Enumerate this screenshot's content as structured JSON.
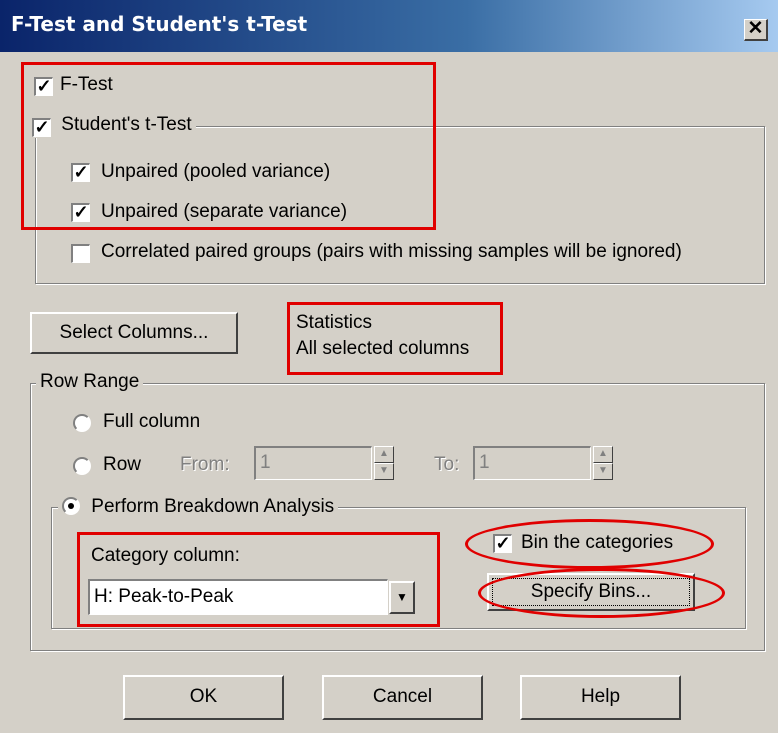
{
  "window": {
    "title": "F-Test and Student's t-Test",
    "close_glyph": "✕"
  },
  "tests": {
    "ftest": {
      "label": "F-Test",
      "checked": true
    },
    "ttest": {
      "label": "Student's t-Test",
      "checked": true
    },
    "options": [
      {
        "label": "Unpaired (pooled variance)",
        "checked": true
      },
      {
        "label": "Unpaired (separate variance)",
        "checked": true
      },
      {
        "label": "Correlated paired groups (pairs with missing samples will be ignored)",
        "checked": false
      }
    ]
  },
  "select_columns": {
    "label": "Select Columns..."
  },
  "statistics": {
    "line1": "Statistics",
    "line2": "All selected columns"
  },
  "row_range": {
    "legend": "Row Range",
    "full_column": "Full column",
    "row": "Row",
    "from_label": "From:",
    "from_value": "1",
    "to_label": "To:",
    "to_value": "1",
    "breakdown": "Perform Breakdown Analysis",
    "selected": "breakdown"
  },
  "breakdown": {
    "category_label": "Category column:",
    "category_value": "H: Peak-to-Peak",
    "bin_label": "Bin the categories",
    "bin_checked": true,
    "specify_bins": "Specify Bins..."
  },
  "buttons": {
    "ok": "OK",
    "cancel": "Cancel",
    "help": "Help"
  },
  "colors": {
    "highlight": "#e00000",
    "title_bar": "#0a246a",
    "dialog_bg": "#d4d0c8"
  }
}
